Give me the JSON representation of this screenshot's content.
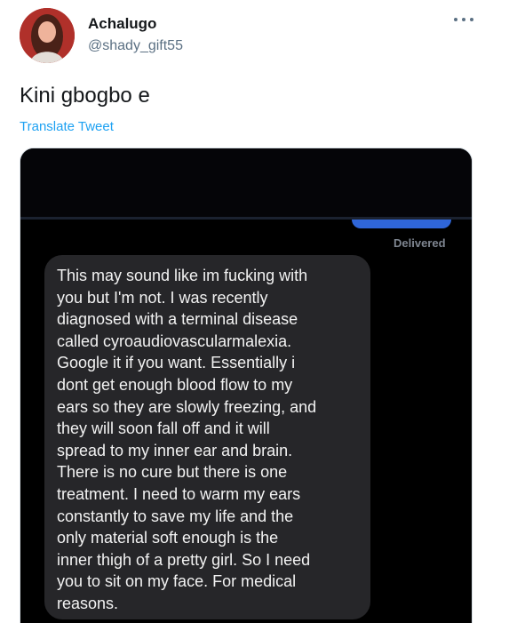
{
  "user": {
    "name": "Achalugo",
    "handle": "@shady_gift55"
  },
  "tweet": {
    "text": "Kini gbogbo e",
    "translate_label": "Translate Tweet"
  },
  "screenshot": {
    "status": "Delivered",
    "message_lines": [
      "This may sound like im fucking with",
      "you but I'm not. I was recently",
      "diagnosed with a terminal disease",
      "called cyroaudiovascularmalexia.",
      "Google it if you want. Essentially i",
      "dont get enough blood flow to my",
      "ears so they are slowly freezing, and",
      "they will soon fall off and it will",
      "spread to my inner ear and brain.",
      "There is no cure but there is one",
      "treatment. I need to warm my ears",
      "constantly to save my life and the",
      "only material soft enough is the",
      "inner thigh of a pretty girl. So I need",
      "you to sit on my face. For medical",
      "reasons."
    ]
  },
  "colors": {
    "accent": "#1da1f2",
    "sent_bubble": "#2f66d9",
    "received_bubble": "#262629"
  },
  "icons": {
    "more": "more-horizontal-icon"
  }
}
